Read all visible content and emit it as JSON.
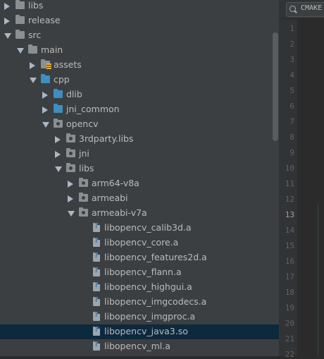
{
  "project_tree": {
    "items": [
      {
        "label": "libs",
        "depth": 0,
        "expanded": false,
        "icon": "folder-icon",
        "kind": "folder"
      },
      {
        "label": "release",
        "depth": 0,
        "expanded": false,
        "icon": "folder-icon",
        "kind": "folder"
      },
      {
        "label": "src",
        "depth": 0,
        "expanded": true,
        "icon": "folder-icon",
        "kind": "folder"
      },
      {
        "label": "main",
        "depth": 1,
        "expanded": true,
        "icon": "folder-icon",
        "kind": "folder"
      },
      {
        "label": "assets",
        "depth": 2,
        "expanded": false,
        "icon": "resource-folder-icon",
        "kind": "res"
      },
      {
        "label": "cpp",
        "depth": 2,
        "expanded": true,
        "icon": "source-folder-icon",
        "kind": "blue"
      },
      {
        "label": "dlib",
        "depth": 3,
        "expanded": false,
        "icon": "source-folder-icon",
        "kind": "blue"
      },
      {
        "label": "jni_common",
        "depth": 3,
        "expanded": false,
        "icon": "source-folder-icon",
        "kind": "blue"
      },
      {
        "label": "opencv",
        "depth": 3,
        "expanded": true,
        "icon": "package-icon",
        "kind": "pkg"
      },
      {
        "label": "3rdparty.libs",
        "depth": 4,
        "expanded": false,
        "icon": "package-icon",
        "kind": "pkg"
      },
      {
        "label": "jni",
        "depth": 4,
        "expanded": false,
        "icon": "package-icon",
        "kind": "pkg"
      },
      {
        "label": "libs",
        "depth": 4,
        "expanded": true,
        "icon": "package-icon",
        "kind": "pkg"
      },
      {
        "label": "arm64-v8a",
        "depth": 5,
        "expanded": false,
        "icon": "package-icon",
        "kind": "pkg"
      },
      {
        "label": "armeabi",
        "depth": 5,
        "expanded": false,
        "icon": "package-icon",
        "kind": "pkg"
      },
      {
        "label": "armeabi-v7a",
        "depth": 5,
        "expanded": true,
        "icon": "package-icon",
        "kind": "pkg"
      },
      {
        "label": "libopencv_calib3d.a",
        "depth": 6,
        "icon": "unknown-file-icon",
        "kind": "file"
      },
      {
        "label": "libopencv_core.a",
        "depth": 6,
        "icon": "unknown-file-icon",
        "kind": "file"
      },
      {
        "label": "libopencv_features2d.a",
        "depth": 6,
        "icon": "unknown-file-icon",
        "kind": "file"
      },
      {
        "label": "libopencv_flann.a",
        "depth": 6,
        "icon": "unknown-file-icon",
        "kind": "file"
      },
      {
        "label": "libopencv_highgui.a",
        "depth": 6,
        "icon": "unknown-file-icon",
        "kind": "file"
      },
      {
        "label": "libopencv_imgcodecs.a",
        "depth": 6,
        "icon": "unknown-file-icon",
        "kind": "file"
      },
      {
        "label": "libopencv_imgproc.a",
        "depth": 6,
        "icon": "unknown-file-icon",
        "kind": "file"
      },
      {
        "label": "libopencv_java3.so",
        "depth": 6,
        "icon": "unknown-file-icon",
        "kind": "file",
        "selected": true
      },
      {
        "label": "libopencv_ml.a",
        "depth": 6,
        "icon": "unknown-file-icon",
        "kind": "file"
      }
    ]
  },
  "editor": {
    "breadcrumb": "CMAKE",
    "current_line": "13",
    "line_numbers": [
      "1",
      "2",
      "3",
      "4",
      "5",
      "6",
      "7",
      "8",
      "9",
      "10",
      "11",
      "12",
      "13",
      "14",
      "15",
      "16",
      "17",
      "18",
      "19",
      "20",
      "21",
      "22"
    ]
  },
  "colors": {
    "tree_background": "#3c3f41",
    "selection": "#0d293e",
    "source_folder": "#3d8fbf",
    "editor_background": "#2b2b2b"
  }
}
